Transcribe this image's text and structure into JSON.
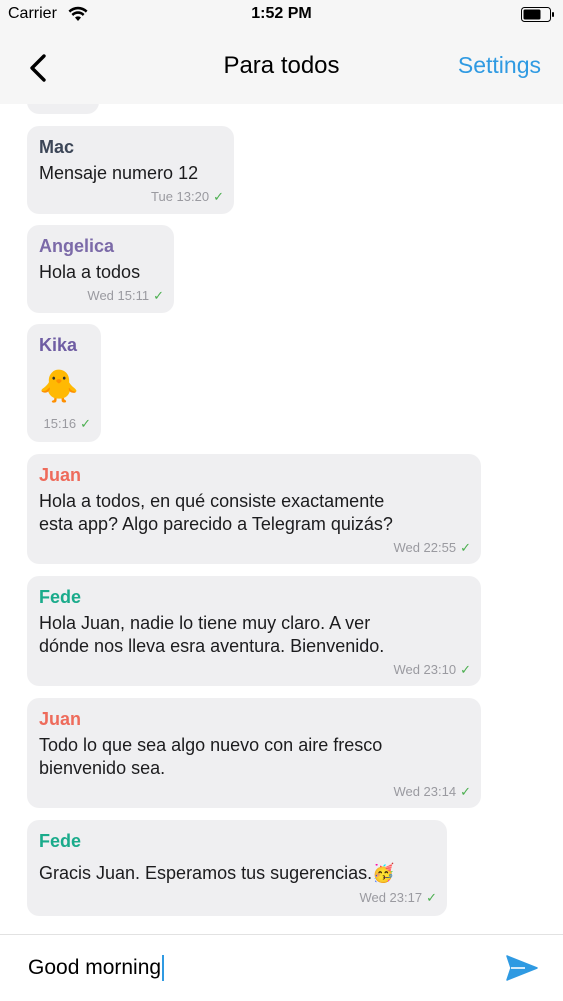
{
  "status_bar": {
    "carrier": "Carrier",
    "time": "1:52 PM"
  },
  "nav": {
    "title": "Para todos",
    "settings_label": "Settings"
  },
  "colors": {
    "accent": "#2f9ae2",
    "check": "#4caf50",
    "bubble": "#efeff1"
  },
  "messages": [
    {
      "sender": "Mac",
      "sender_color": "#3c4657",
      "text": "Mensaje numero 12",
      "time": "Tue 13:20",
      "status_icon": "check-icon"
    },
    {
      "sender": "Angelica",
      "sender_color": "#7b6aa8",
      "text": "Hola a todos",
      "time": "Wed 15:11",
      "status_icon": "check-icon"
    },
    {
      "sender": "Kika",
      "sender_color": "#6f5da3",
      "text": "🐥",
      "time": "15:16",
      "status_icon": "check-icon"
    },
    {
      "sender": "Juan",
      "sender_color": "#ee6b5b",
      "text": "Hola a todos, en qué consiste exactamente\nesta app? Algo parecido a Telegram quizás?",
      "time": "Wed 22:55",
      "status_icon": "check-icon"
    },
    {
      "sender": "Fede",
      "sender_color": "#1aab8b",
      "text": "Hola Juan, nadie lo tiene muy claro. A ver\ndónde nos lleva esra aventura. Bienvenido.",
      "time": "Wed 23:10",
      "status_icon": "check-icon"
    },
    {
      "sender": "Juan",
      "sender_color": "#ee6b5b",
      "text": "Todo lo que sea algo nuevo con aire fresco\nbienvenido sea.",
      "time": "Wed 23:14",
      "status_icon": "check-icon"
    },
    {
      "sender": "Fede",
      "sender_color": "#1aab8b",
      "text": "Gracis Juan. Esperamos tus sugerencias.🥳",
      "time": "Wed 23:17",
      "status_icon": "check-icon"
    }
  ],
  "composer": {
    "value": "Good morning",
    "send_icon": "send-icon"
  }
}
